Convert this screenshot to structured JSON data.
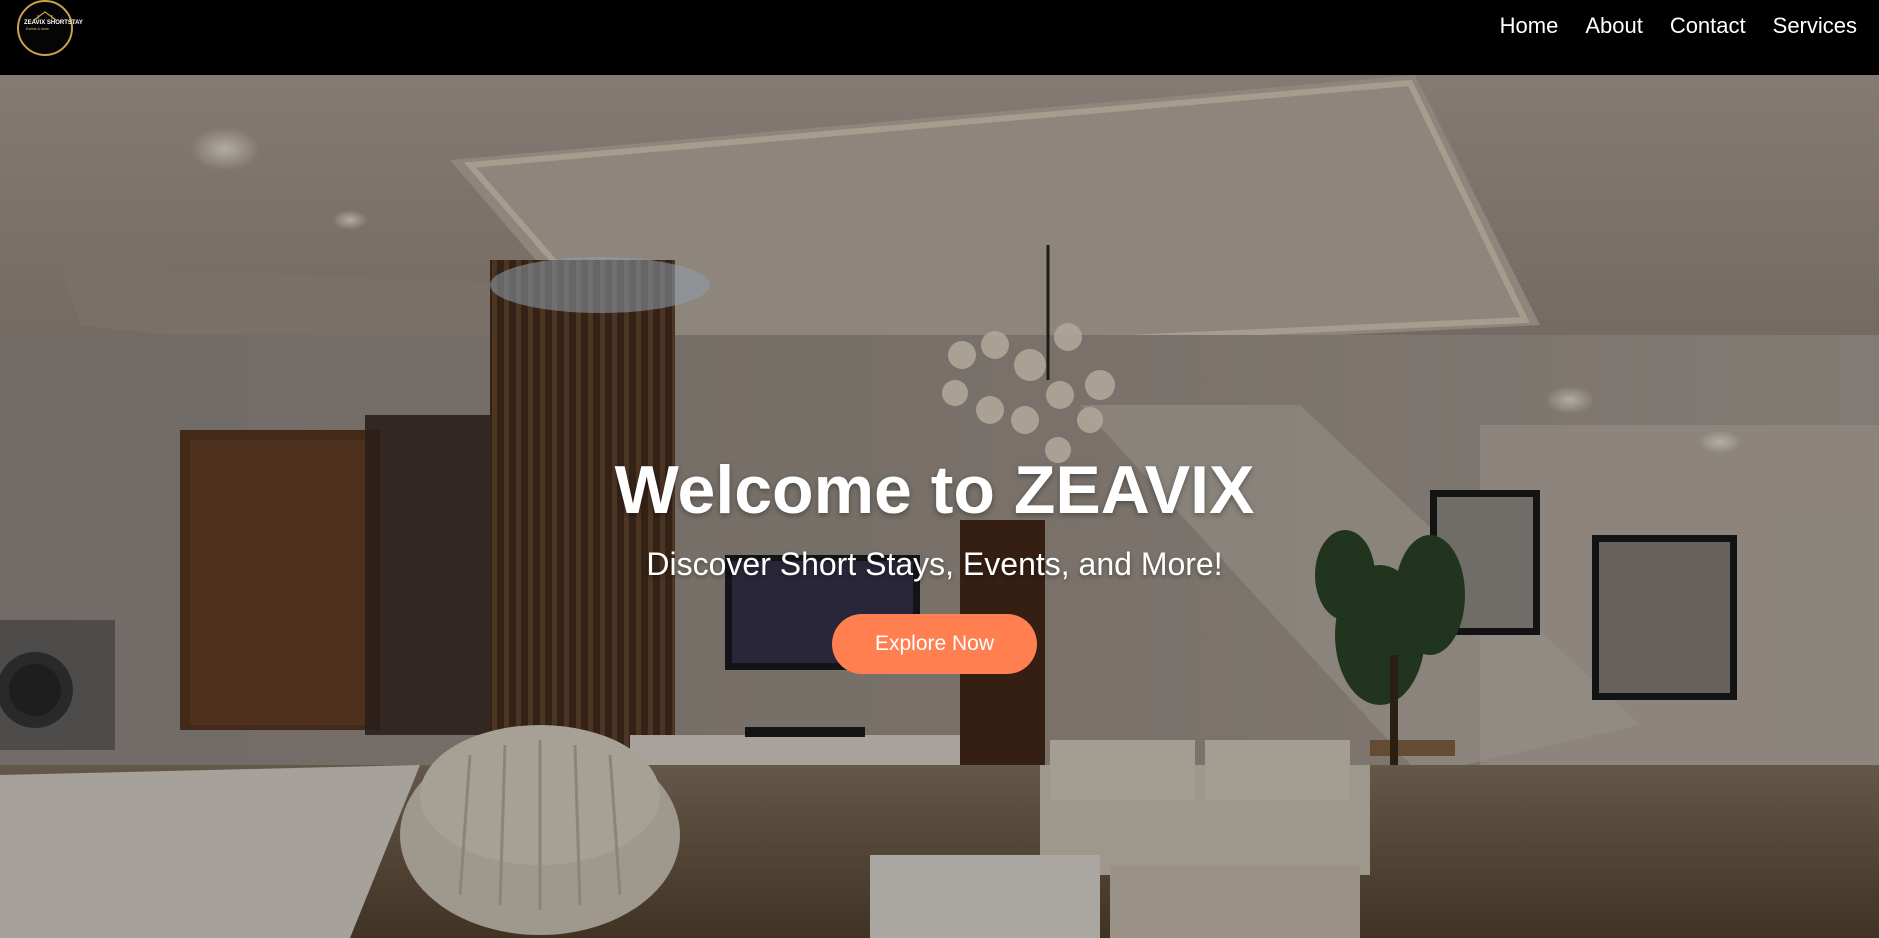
{
  "brand": {
    "logo_text": "ZEAVIX SHORTSTAY",
    "logo_subtext": "Events & more"
  },
  "nav": {
    "items": [
      {
        "label": "Home"
      },
      {
        "label": "About"
      },
      {
        "label": "Contact"
      },
      {
        "label": "Services"
      }
    ]
  },
  "hero": {
    "title": "Welcome to ZEAVIX",
    "subtitle": "Discover Short Stays, Events, and More!",
    "cta_label": "Explore Now",
    "image": "living-room-interior-photo"
  },
  "colors": {
    "nav_background": "#000000",
    "accent": "#ff7f50",
    "text": "#ffffff",
    "logo_ring": "#c9a14a"
  }
}
